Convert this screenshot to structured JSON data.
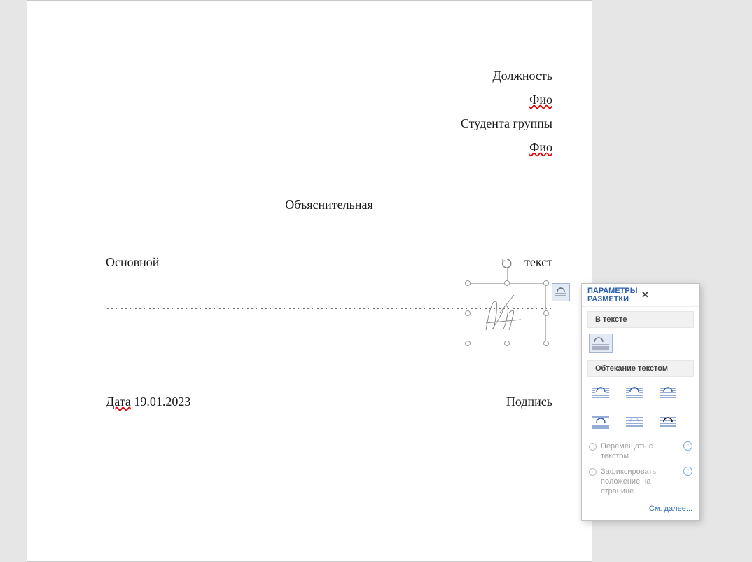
{
  "document": {
    "header": {
      "position_label": "Должность",
      "fio1": "Фио",
      "student_group_label": "Студента группы",
      "fio2": "Фио"
    },
    "title": "Объяснительная",
    "body": {
      "word1": "Основной",
      "word2": "текст",
      "dots": "…………………………………………………………………………………………."
    },
    "footer": {
      "date_word": "Дата",
      "date_value": "19.01.2023",
      "signature_label": "Подпись"
    }
  },
  "panel": {
    "title": "ПАРАМЕТРЫ РАЗМЕТКИ",
    "section_inline": "В тексте",
    "section_wrap": "Обтекание текстом",
    "radio_move": "Перемещать с текстом",
    "radio_fix": "Зафиксировать положение на странице",
    "see_more": "См. далее...",
    "close": "✕",
    "info": "i"
  }
}
